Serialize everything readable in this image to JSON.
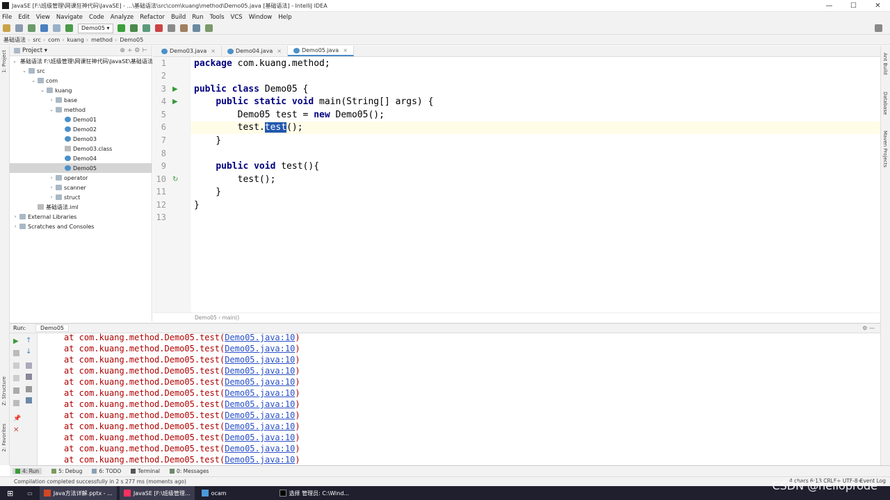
{
  "window": {
    "title": "JavaSE [F:\\班级管理\\网课狂神代码\\JavaSE] - ...\\基础语法\\src\\com\\kuang\\method\\Demo05.java [基础语法] - IntelliJ IDEA",
    "min": "—",
    "max": "☐",
    "close": "✕"
  },
  "menu": [
    "File",
    "Edit",
    "View",
    "Navigate",
    "Code",
    "Analyze",
    "Refactor",
    "Build",
    "Run",
    "Tools",
    "VCS",
    "Window",
    "Help"
  ],
  "toolbar": {
    "run_config": "Demo05 ▾"
  },
  "nav": [
    "基础语法",
    "src",
    "com",
    "kuang",
    "method",
    "Demo05"
  ],
  "left_strip": {
    "project": "1: Project",
    "structure": "Z: Structure",
    "favorites": "2: Favorites"
  },
  "right_strip": {
    "ant": "Ant Build",
    "database": "Database",
    "maven": "Maven Projects"
  },
  "project": {
    "header": "Project ▾",
    "rows": [
      {
        "label": "基础语法  F:\\班级管理\\网课狂神代码\\JavaSE\\基础语法",
        "indent": 0,
        "arrow": "v",
        "icon": "folder"
      },
      {
        "label": "src",
        "indent": 1,
        "arrow": "v",
        "icon": "folder"
      },
      {
        "label": "com",
        "indent": 2,
        "arrow": "v",
        "icon": "folder"
      },
      {
        "label": "kuang",
        "indent": 3,
        "arrow": "v",
        "icon": "folder"
      },
      {
        "label": "base",
        "indent": 4,
        "arrow": ">",
        "icon": "folder"
      },
      {
        "label": "method",
        "indent": 4,
        "arrow": "v",
        "icon": "folder"
      },
      {
        "label": "Demo01",
        "indent": 5,
        "arrow": "",
        "icon": "cls"
      },
      {
        "label": "Demo02",
        "indent": 5,
        "arrow": "",
        "icon": "cls"
      },
      {
        "label": "Demo03",
        "indent": 5,
        "arrow": "",
        "icon": "cls"
      },
      {
        "label": "Demo03.class",
        "indent": 5,
        "arrow": "",
        "icon": "file"
      },
      {
        "label": "Demo04",
        "indent": 5,
        "arrow": "",
        "icon": "cls"
      },
      {
        "label": "Demo05",
        "indent": 5,
        "arrow": "",
        "icon": "cls",
        "selected": true
      },
      {
        "label": "operator",
        "indent": 4,
        "arrow": ">",
        "icon": "folder"
      },
      {
        "label": "scanner",
        "indent": 4,
        "arrow": ">",
        "icon": "folder"
      },
      {
        "label": "struct",
        "indent": 4,
        "arrow": ">",
        "icon": "folder"
      },
      {
        "label": "基础语法.iml",
        "indent": 2,
        "arrow": "",
        "icon": "file"
      },
      {
        "label": "External Libraries",
        "indent": 0,
        "arrow": ">",
        "icon": "folder"
      },
      {
        "label": "Scratches and Consoles",
        "indent": 0,
        "arrow": ">",
        "icon": "folder"
      }
    ]
  },
  "tabs": [
    {
      "label": "Demo03.java",
      "active": false
    },
    {
      "label": "Demo04.java",
      "active": false
    },
    {
      "label": "Demo05.java",
      "active": true
    }
  ],
  "code": {
    "line_numbers": [
      "1",
      "2",
      "3",
      "4",
      "5",
      "6",
      "7",
      "8",
      "9",
      "10",
      "11",
      "12",
      "13"
    ],
    "lines": [
      "package com.kuang.method;",
      "",
      "public class Demo05 {",
      "    public static void main(String[] args) {",
      "        Demo05 test = new Demo05();",
      "        test.test();",
      "    }",
      "",
      "    public void test(){",
      "        test();",
      "    }",
      "}",
      ""
    ]
  },
  "editor_crumb": "Demo05  ›  main()",
  "run": {
    "label": "Run:",
    "config": "Demo05",
    "line_prefix": "at com.kuang.method.Demo05.test(",
    "line_link": "Demo05.java:10",
    "line_suffix": ")",
    "count": 12
  },
  "bottom_tabs": [
    "4: Run",
    "5: Debug",
    "6: TODO",
    "Terminal",
    "0: Messages"
  ],
  "status": {
    "message": "Compilation completed successfully in 2 s 277 ms (moments ago)",
    "right": "4 chars   6:13   CRLF÷   UTF-8÷",
    "event_log": "Event Log"
  },
  "taskbar": [
    "Java方法详解.pptx - ...",
    "JavaSE [F:\\班级管理...",
    "ocam",
    "选择 管理员: C:\\Wind..."
  ],
  "watermark": "CSDN @helloprode"
}
